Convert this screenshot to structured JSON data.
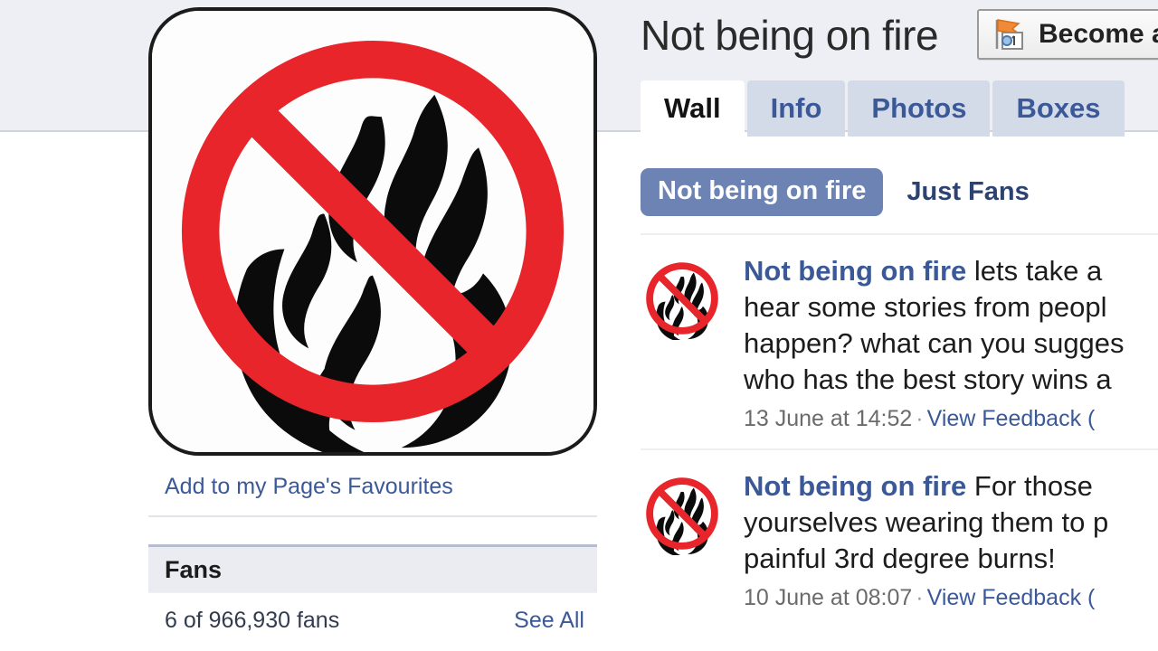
{
  "page": {
    "title": "Not being on fire",
    "profile_picture_icon": "no-fire-prohibition-icon"
  },
  "header": {
    "become_fan_label": "Become a",
    "become_fan_icon": "page-flag-icon"
  },
  "tabs": [
    {
      "label": "Wall",
      "active": true
    },
    {
      "label": "Info",
      "active": false
    },
    {
      "label": "Photos",
      "active": false
    },
    {
      "label": "Boxes",
      "active": false
    }
  ],
  "filters": {
    "selected": "Not being on fire",
    "other": "Just Fans"
  },
  "sidebar": {
    "favourites_link": "Add to my Page's Favourites",
    "fans_box": {
      "title": "Fans",
      "count_text": "6 of 966,930 fans",
      "see_all_label": "See All"
    }
  },
  "wall": {
    "posts": [
      {
        "author": "Not being on fire",
        "avatar_icon": "no-fire-prohibition-icon",
        "lines": [
          " lets take a",
          "hear some stories from peopl",
          "happen? what can you sugges",
          "who has the best story wins a"
        ],
        "timestamp": "13 June at 14:52",
        "feedback_label": "View Feedback ("
      },
      {
        "author": "Not being on fire",
        "avatar_icon": "no-fire-prohibition-icon",
        "lines": [
          " For those ",
          "yourselves wearing them to p",
          "painful 3rd degree burns!"
        ],
        "timestamp": "10 June at 08:07",
        "feedback_label": "View Feedback ("
      }
    ]
  },
  "colors": {
    "facebook_blue": "#3b5998",
    "tab_inactive_bg": "#d3dbe9",
    "filter_pill_bg": "#6d83b3",
    "chrome_band": "#edeff4",
    "fans_header_bg": "#eaecf1",
    "prohibition_red": "#e8252a"
  }
}
